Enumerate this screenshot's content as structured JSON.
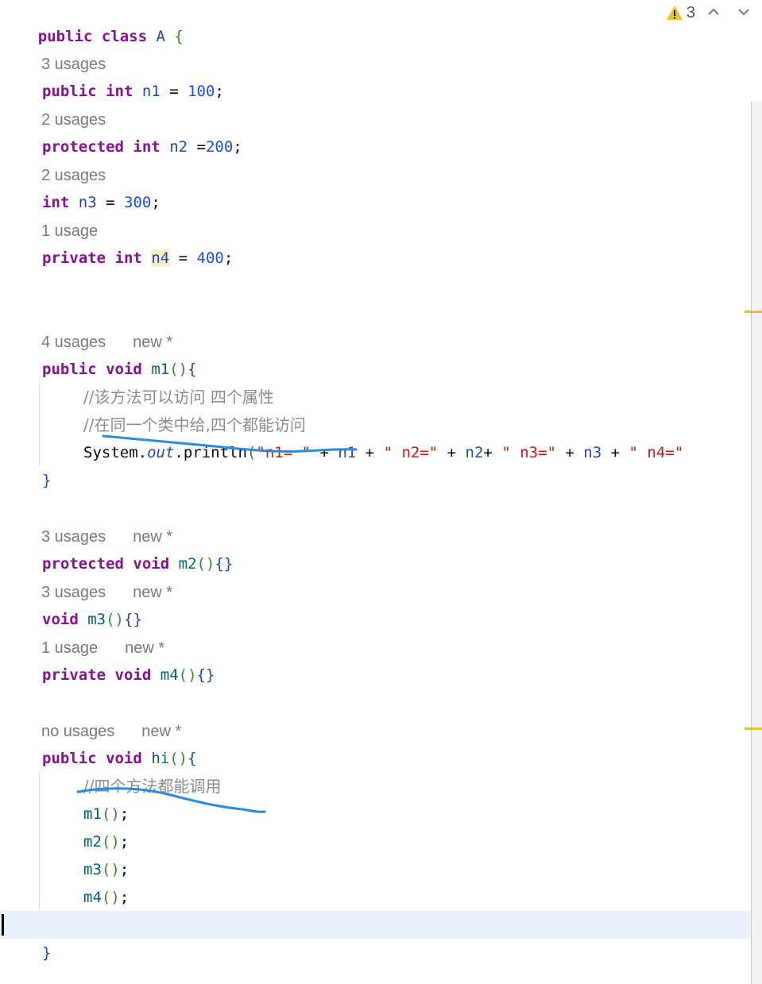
{
  "header": {
    "class_decl": {
      "kw1": "public",
      "kw2": "class",
      "name": "A",
      "brace": "{"
    },
    "warning_count": "3"
  },
  "fields": [
    {
      "usage": "3 usages",
      "modifier": "public",
      "type": "int",
      "name": "n1",
      "op": " = ",
      "value": "100",
      "end": ";"
    },
    {
      "usage": "2 usages",
      "modifier": "protected",
      "type": "int",
      "name": "n2",
      "op": " =",
      "value": "200",
      "end": ";"
    },
    {
      "usage": "2 usages",
      "type": "int",
      "name": "n3",
      "op": " = ",
      "value": "300",
      "end": ";"
    },
    {
      "usage": "1 usage",
      "modifier": "private",
      "type": "int",
      "name": "n4",
      "op": " = ",
      "value": "400",
      "end": ";"
    }
  ],
  "m1": {
    "usage": "4 usages",
    "new_tag": "new *",
    "kw1": "public",
    "kw2": "void",
    "name": "m1",
    "comment1": "//该方法可以访问 四个属性",
    "comment2": "//在同一个类中给,四个都能访问",
    "println": {
      "prefix": "System.",
      "out": "out",
      "method": ".println",
      "s1": "\"n1= \"",
      "v1": "n1",
      "s2": "\" n2=\"",
      "v2": "n2",
      "s3": "\" n3=\"",
      "v3": "n3",
      "s4": "\" n4=\""
    }
  },
  "m2": {
    "usage": "3 usages",
    "new_tag": "new *",
    "kw1": "protected",
    "kw2": "void",
    "name": "m2"
  },
  "m3": {
    "usage": "3 usages",
    "new_tag": "new *",
    "kw1": "void",
    "name": "m3"
  },
  "m4": {
    "usage": "1 usage",
    "new_tag": "new *",
    "kw1": "private",
    "kw2": "void",
    "name": "m4"
  },
  "hi": {
    "usage": "no usages",
    "new_tag": "new *",
    "kw1": "public",
    "kw2": "void",
    "name": "hi",
    "comment": "//四个方法都能调用",
    "calls": [
      "m1",
      "m2",
      "m3",
      "m4"
    ]
  },
  "symbols": {
    "open_brace": "{",
    "close_brace": "}",
    "empty_braces": "{}",
    "parens": "()",
    "semi": ";",
    "plus": " + "
  },
  "icons": [
    "warning-icon",
    "chevron-up-icon",
    "chevron-down-icon"
  ],
  "colors": {
    "keyword": "#871094",
    "number": "#1750eb",
    "string": "#c41a16",
    "comment": "#8c8c8c",
    "annotation_ink": "#2a8be0"
  }
}
